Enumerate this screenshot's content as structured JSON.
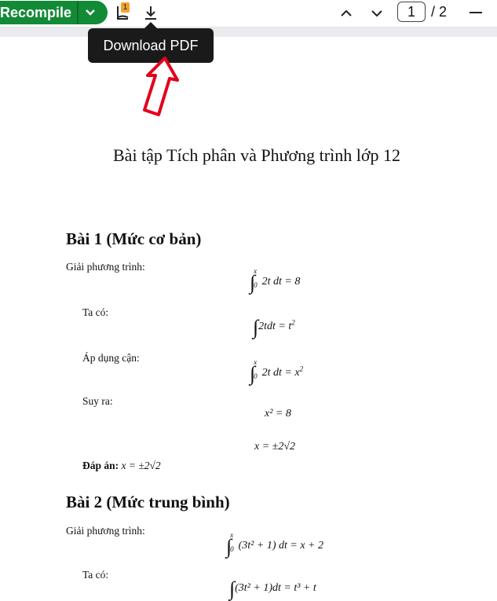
{
  "toolbar": {
    "recompile_label": "Recompile",
    "logs_badge": "1",
    "page_current": "1",
    "page_total": "/ 2"
  },
  "tooltip": {
    "text": "Download PDF"
  },
  "document": {
    "title": "Bài tập Tích phân và Phương trình lớp 12",
    "sections": [
      {
        "heading": "Bài 1 (Mức cơ bản)",
        "intro": "Giải phương trình:",
        "eq1": "2t dt = 8",
        "step1": "Ta có:",
        "eq2": "2tdt = t",
        "step2": "Áp dụng cận:",
        "eq3": "2t dt = x",
        "step3": "Suy ra:",
        "eq4": "x² = 8",
        "eq5": "x = ±2√2",
        "answer_label": "Đáp án:",
        "answer_value": "x = ±2√2"
      },
      {
        "heading": "Bài 2 (Mức trung bình)",
        "intro": "Giải phương trình:",
        "eq1": "(3t² + 1) dt = x + 2",
        "step1": "Ta có:",
        "eq2": "(3t² + 1)dt = t³ + t"
      }
    ]
  },
  "colors": {
    "accent": "#138a36",
    "badge": "#f0a330",
    "tooltip_bg": "#1a1a1a",
    "arrow": "#e3001b"
  },
  "icons": [
    "chevron-down-icon",
    "logs-icon",
    "download-icon",
    "chevron-up-icon",
    "chevron-down-icon",
    "minus-icon"
  ]
}
